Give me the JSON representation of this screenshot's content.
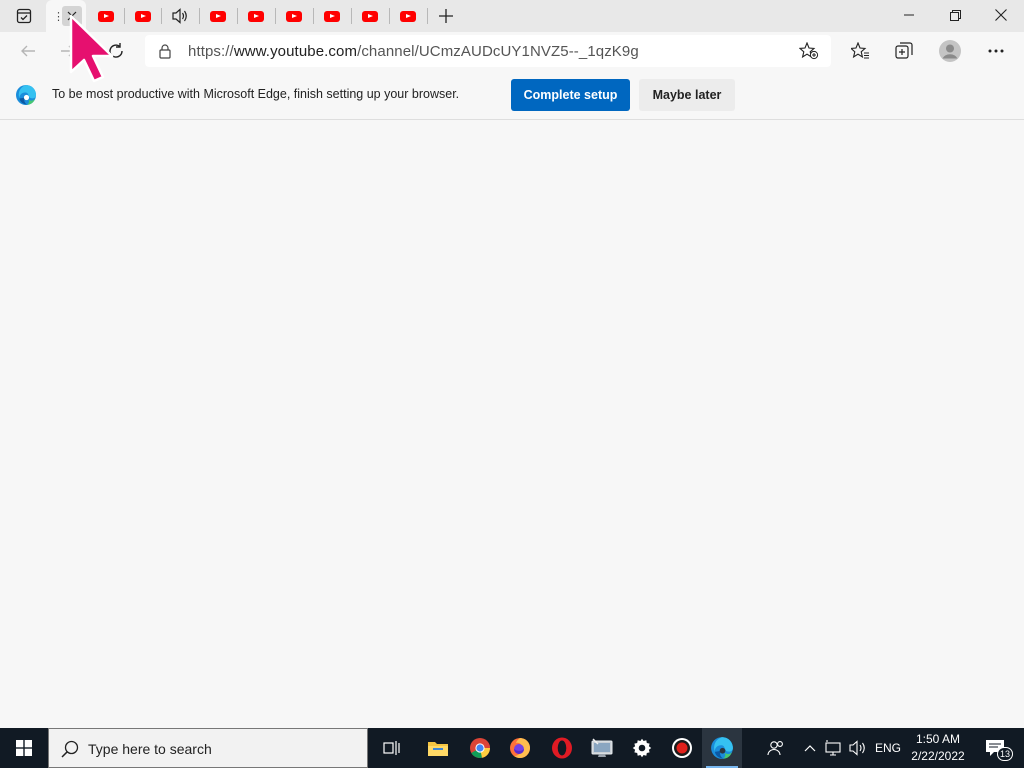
{
  "browser": {
    "url_scheme": "https://",
    "url_host": "www.youtube.com",
    "url_path": "/channel/UCmzAUDcUY1NVZ5--_1qzK9g",
    "infobar_text": "To be most productive with Microsoft Edge, finish setting up your browser.",
    "complete_setup_label": "Complete setup",
    "maybe_later_label": "Maybe later",
    "tab_count": 10,
    "accent_color": "#0067c0",
    "youtube_color": "#ff0000"
  },
  "taskbar": {
    "search_placeholder": "Type here to search",
    "lang": "ENG",
    "time": "1:50 AM",
    "date": "2/22/2022",
    "notification_count": "13"
  }
}
